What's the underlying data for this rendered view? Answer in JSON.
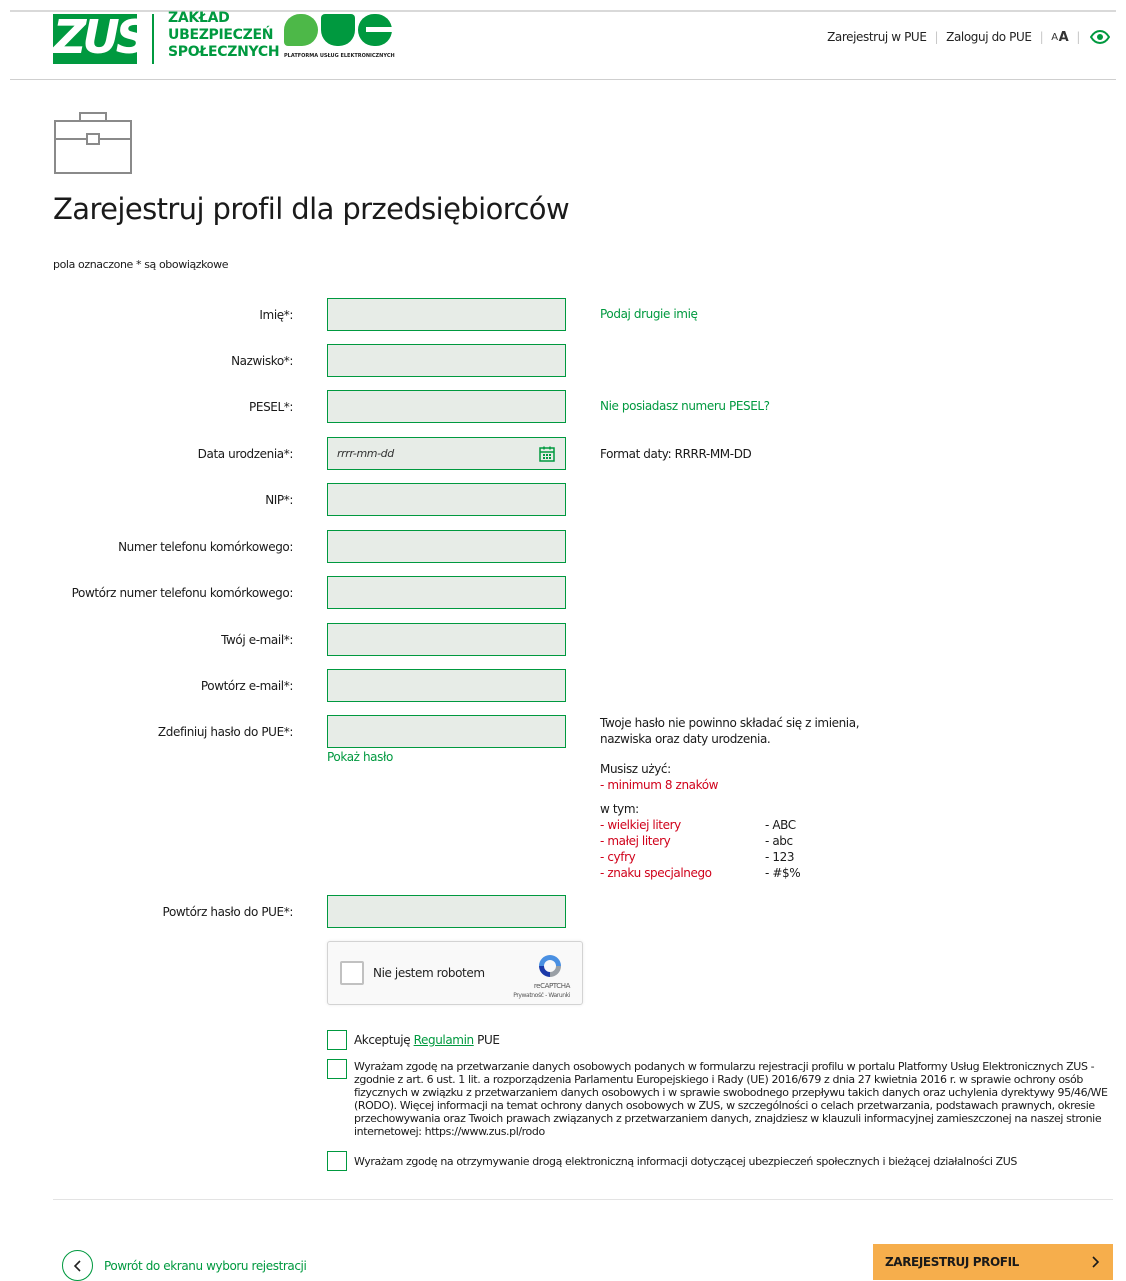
{
  "header": {
    "zus_logo_text": "ZUS",
    "org_name": [
      "ZAKŁAD",
      "UBEZPIECZEŃ",
      "SPOŁECZNYCH"
    ],
    "pue_logo_tag": "PLATFORMA USŁUG ELEKTRONICZNYCH",
    "register_link": "Zarejestruj w PUE",
    "login_link": "Zaloguj do PUE",
    "font_small": "A",
    "font_big": "A",
    "contrast_icon": "eye-icon"
  },
  "page": {
    "title": "Zarejestruj profil dla przedsiębiorców",
    "required_note": "pola oznaczone * są obowiązkowe",
    "icon": "briefcase-icon"
  },
  "form": {
    "first_name_label": "Imię*:",
    "last_name_label": "Nazwisko*:",
    "pesel_label": "PESEL*:",
    "birth_date_label": "Data urodzenia*:",
    "birth_date_placeholder": "rrrr-mm-dd",
    "nip_label": "NIP*:",
    "phone_label": "Numer telefonu komórkowego:",
    "phone_repeat_label": "Powtórz numer telefonu komórkowego:",
    "email_label": "Twój e-mail*:",
    "email_repeat_label": "Powtórz e-mail*:",
    "password_label": "Zdefiniuj hasło do PUE*:",
    "password_repeat_label": "Powtórz hasło do PUE*:",
    "second_name_link": "Podaj drugie imię",
    "no_pesel_link": "Nie posiadasz numeru PESEL?",
    "date_format_hint": "Format daty: RRRR-MM-DD",
    "show_password": "Pokaż hasło",
    "password_note_1": "Twoje hasło nie powinno składać się z imienia,",
    "password_note_2": "nazwiska oraz daty urodzenia.",
    "must_use": "Musisz użyć:",
    "min_chars": "- minimum 8 znaków",
    "including": "w tym:",
    "rules": [
      {
        "label": "- wielkiej litery",
        "example": "- ABC"
      },
      {
        "label": "- małej litery",
        "example": "- abc"
      },
      {
        "label": "- cyfry",
        "example": "- 123"
      },
      {
        "label": "- znaku specjalnego",
        "example": "- #$%"
      }
    ]
  },
  "captcha": {
    "label": "Nie jestem robotem",
    "brand": "reCAPTCHA",
    "links": "Prywatność - Warunki"
  },
  "consents": {
    "accept_prefix": "Akceptuję",
    "accept_link": "Regulamin",
    "accept_suffix": "PUE",
    "gdpr_lines": [
      "Wyrażam zgodę na przetwarzanie danych osobowych podanych w formularzu rejestracji profilu w portalu Platformy Usług Elektronicznych ZUS -",
      "zgodnie z art. 6 ust. 1 lit. a rozporządzenia Parlamentu Europejskiego i Rady (UE) 2016/679 z dnia 27 kwietnia 2016 r. w sprawie ochrony osób",
      "fizycznych w związku z przetwarzaniem danych osobowych i w sprawie swobodnego przepływu takich danych oraz uchylenia dyrektywy 95/46/WE",
      "(RODO). Więcej informacji na temat ochrony danych osobowych w ZUS, w szczególności o celach przetwarzania, podstawach prawnych, okresie",
      "przechowywania oraz Twoich prawach związanych z przetwarzaniem danych, znajdziesz w klauzuli informacyjnej zamieszczonej na naszej stronie",
      "internetowej: https://www.zus.pl/rodo"
    ],
    "marketing": "Wyrażam zgodę na otrzymywanie drogą elektroniczną informacji dotyczącej ubezpieczeń społecznych i bieżącej działalności ZUS"
  },
  "footer": {
    "back_label": "Powrót do ekranu wyboru rejestracji",
    "submit_label": "ZAREJESTRUJ PROFIL"
  },
  "colors": {
    "brand_green": "#00993f",
    "field_bg": "#e7ece7",
    "submit_orange": "#f6ae4c",
    "error_red": "#d0021b"
  }
}
